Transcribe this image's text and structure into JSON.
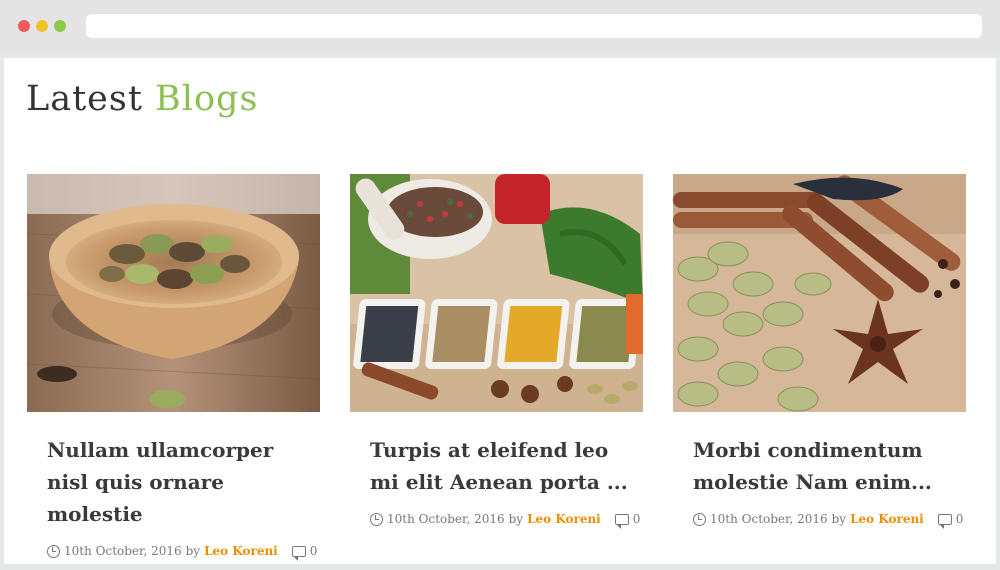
{
  "section": {
    "title_plain": "Latest ",
    "title_accent": "Blogs"
  },
  "colors": {
    "accent": "#8cc152",
    "author": "#f08c00"
  },
  "posts": [
    {
      "image": "cardamom-bowl-photo",
      "title": "Nullam ullamcorper nisl quis ornare molestie",
      "date": "10th October, 2016",
      "by": "by",
      "author": "Leo Koreni",
      "comments": "0"
    },
    {
      "image": "spice-bowls-photo",
      "title": "Turpis at eleifend leo mi elit Aenean porta ...",
      "date": "10th October, 2016",
      "by": "by",
      "author": "Leo Koreni",
      "comments": "0"
    },
    {
      "image": "cinnamon-cardamom-photo",
      "title": "Morbi condimentum molestie Nam enim...",
      "date": "10th October, 2016",
      "by": "by",
      "author": "Leo Koreni",
      "comments": "0"
    }
  ]
}
